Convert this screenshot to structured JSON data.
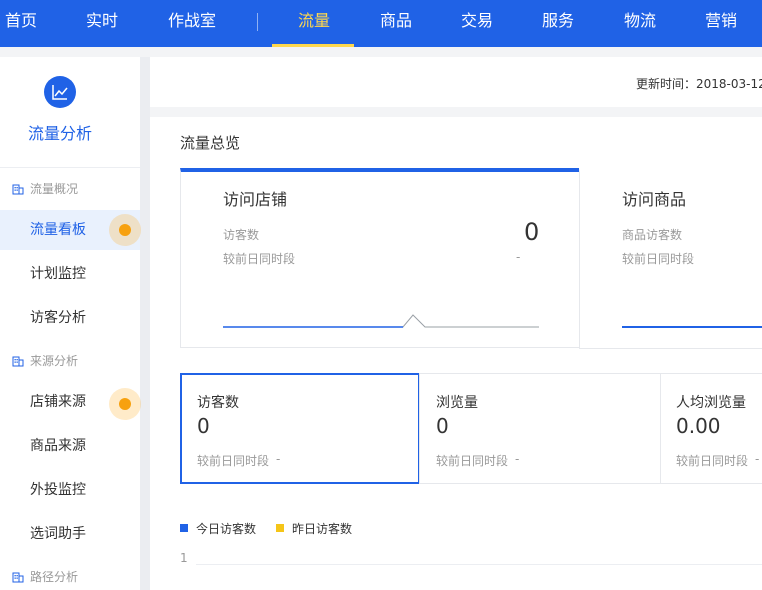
{
  "nav": {
    "items": [
      "首页",
      "实时",
      "作战室",
      "流量",
      "商品",
      "交易",
      "服务",
      "物流",
      "营销"
    ],
    "active": "流量"
  },
  "sidebar": {
    "title": "流量分析",
    "groups": [
      {
        "label": "流量概况",
        "items": [
          "流量看板",
          "计划监控",
          "访客分析"
        ]
      },
      {
        "label": "来源分析",
        "items": [
          "店铺来源",
          "商品来源",
          "外投监控",
          "选词助手"
        ]
      },
      {
        "label": "路径分析",
        "items": []
      }
    ],
    "active_item": "流量看板"
  },
  "update": {
    "text": "更新时间：2018-03-12"
  },
  "overview": {
    "title": "流量总览",
    "cards": [
      {
        "title": "访问店铺",
        "metric_label": "访客数",
        "value": "0",
        "compare_label": "较前日同时段",
        "compare_value": "-"
      },
      {
        "title": "访问商品",
        "metric_label": "商品访客数",
        "compare_label": "较前日同时段"
      }
    ]
  },
  "metrics": [
    {
      "label": "访客数",
      "value": "0",
      "sub": "较前日同时段",
      "sub_value": "-"
    },
    {
      "label": "浏览量",
      "value": "0",
      "sub": "较前日同时段",
      "sub_value": "-"
    },
    {
      "label": "人均浏览量",
      "value": "0.00",
      "sub": "较前日同时段",
      "sub_value": "-"
    }
  ],
  "legend": [
    {
      "label": "今日访客数",
      "color": "#2062e6"
    },
    {
      "label": "昨日访客数",
      "color": "#f5c518"
    }
  ],
  "chart": {
    "y_tick": "1"
  },
  "colors": {
    "primary": "#2062e6",
    "nav_active": "#ffd84d",
    "dot": "#f7a10f"
  }
}
